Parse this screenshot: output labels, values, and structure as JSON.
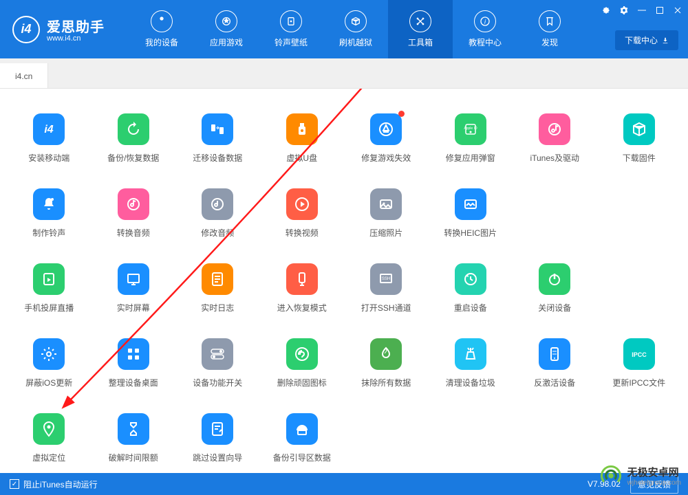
{
  "header": {
    "logo_title": "爱思助手",
    "logo_sub": "www.i4.cn",
    "nav": [
      {
        "label": "我的设备"
      },
      {
        "label": "应用游戏"
      },
      {
        "label": "铃声壁纸"
      },
      {
        "label": "刷机越狱"
      },
      {
        "label": "工具箱"
      },
      {
        "label": "教程中心"
      },
      {
        "label": "发现"
      }
    ],
    "active_nav": 4,
    "download_center": "下载中心"
  },
  "tabs": [
    "i4.cn"
  ],
  "tools": [
    {
      "label": "安装移动端",
      "color": "c-blue",
      "icon": "i4"
    },
    {
      "label": "备份/恢复数据",
      "color": "c-green",
      "icon": "restore"
    },
    {
      "label": "迁移设备数据",
      "color": "c-blue",
      "icon": "migrate"
    },
    {
      "label": "虚拟U盘",
      "color": "c-orange",
      "icon": "usb"
    },
    {
      "label": "修复游戏失效",
      "color": "c-blue",
      "icon": "appstore",
      "dot": true
    },
    {
      "label": "修复应用弹窗",
      "color": "c-green",
      "icon": "appleid"
    },
    {
      "label": "iTunes及驱动",
      "color": "c-pink",
      "icon": "itunes"
    },
    {
      "label": "下载固件",
      "color": "c-teal",
      "icon": "cube"
    },
    {
      "label": "制作铃声",
      "color": "c-blue",
      "icon": "bell"
    },
    {
      "label": "转换音频",
      "color": "c-pink",
      "icon": "audio"
    },
    {
      "label": "修改音频",
      "color": "c-gray",
      "icon": "audioedit"
    },
    {
      "label": "转换视频",
      "color": "c-red",
      "icon": "video"
    },
    {
      "label": "压缩照片",
      "color": "c-gray",
      "icon": "photo"
    },
    {
      "label": "转换HEIC图片",
      "color": "c-blue",
      "icon": "heic"
    },
    {
      "label": "",
      "color": "",
      "icon": ""
    },
    {
      "label": "",
      "color": "",
      "icon": ""
    },
    {
      "label": "手机投屏直播",
      "color": "c-green",
      "icon": "cast"
    },
    {
      "label": "实时屏幕",
      "color": "c-blue",
      "icon": "screen"
    },
    {
      "label": "实时日志",
      "color": "c-orange",
      "icon": "log"
    },
    {
      "label": "进入恢复模式",
      "color": "c-red",
      "icon": "recovery"
    },
    {
      "label": "打开SSH通道",
      "color": "c-gray",
      "icon": "ssh"
    },
    {
      "label": "重启设备",
      "color": "c-mint",
      "icon": "restart"
    },
    {
      "label": "关闭设备",
      "color": "c-green",
      "icon": "power"
    },
    {
      "label": "",
      "color": "",
      "icon": ""
    },
    {
      "label": "屏蔽iOS更新",
      "color": "c-blue",
      "icon": "gear"
    },
    {
      "label": "整理设备桌面",
      "color": "c-blue",
      "icon": "grid"
    },
    {
      "label": "设备功能开关",
      "color": "c-gray",
      "icon": "toggle"
    },
    {
      "label": "删除顽固图标",
      "color": "c-green",
      "icon": "delete"
    },
    {
      "label": "抹除所有数据",
      "color": "c-dgreen",
      "icon": "erase"
    },
    {
      "label": "清理设备垃圾",
      "color": "c-cyan",
      "icon": "clean"
    },
    {
      "label": "反激活设备",
      "color": "c-blue",
      "icon": "deactivate"
    },
    {
      "label": "更新IPCC文件",
      "color": "c-teal",
      "icon": "ipcc"
    },
    {
      "label": "虚拟定位",
      "color": "c-green",
      "icon": "location"
    },
    {
      "label": "破解时间限额",
      "color": "c-blue",
      "icon": "hourglass"
    },
    {
      "label": "跳过设置向导",
      "color": "c-blue",
      "icon": "skip"
    },
    {
      "label": "备份引导区数据",
      "color": "c-blue",
      "icon": "backup"
    }
  ],
  "footer": {
    "checkbox_label": "阻止iTunes自动运行",
    "version": "V7.98.02",
    "feedback": "意见反馈"
  },
  "watermark": {
    "title": "无极安卓网",
    "sub": "wjhotelgroup.com"
  }
}
